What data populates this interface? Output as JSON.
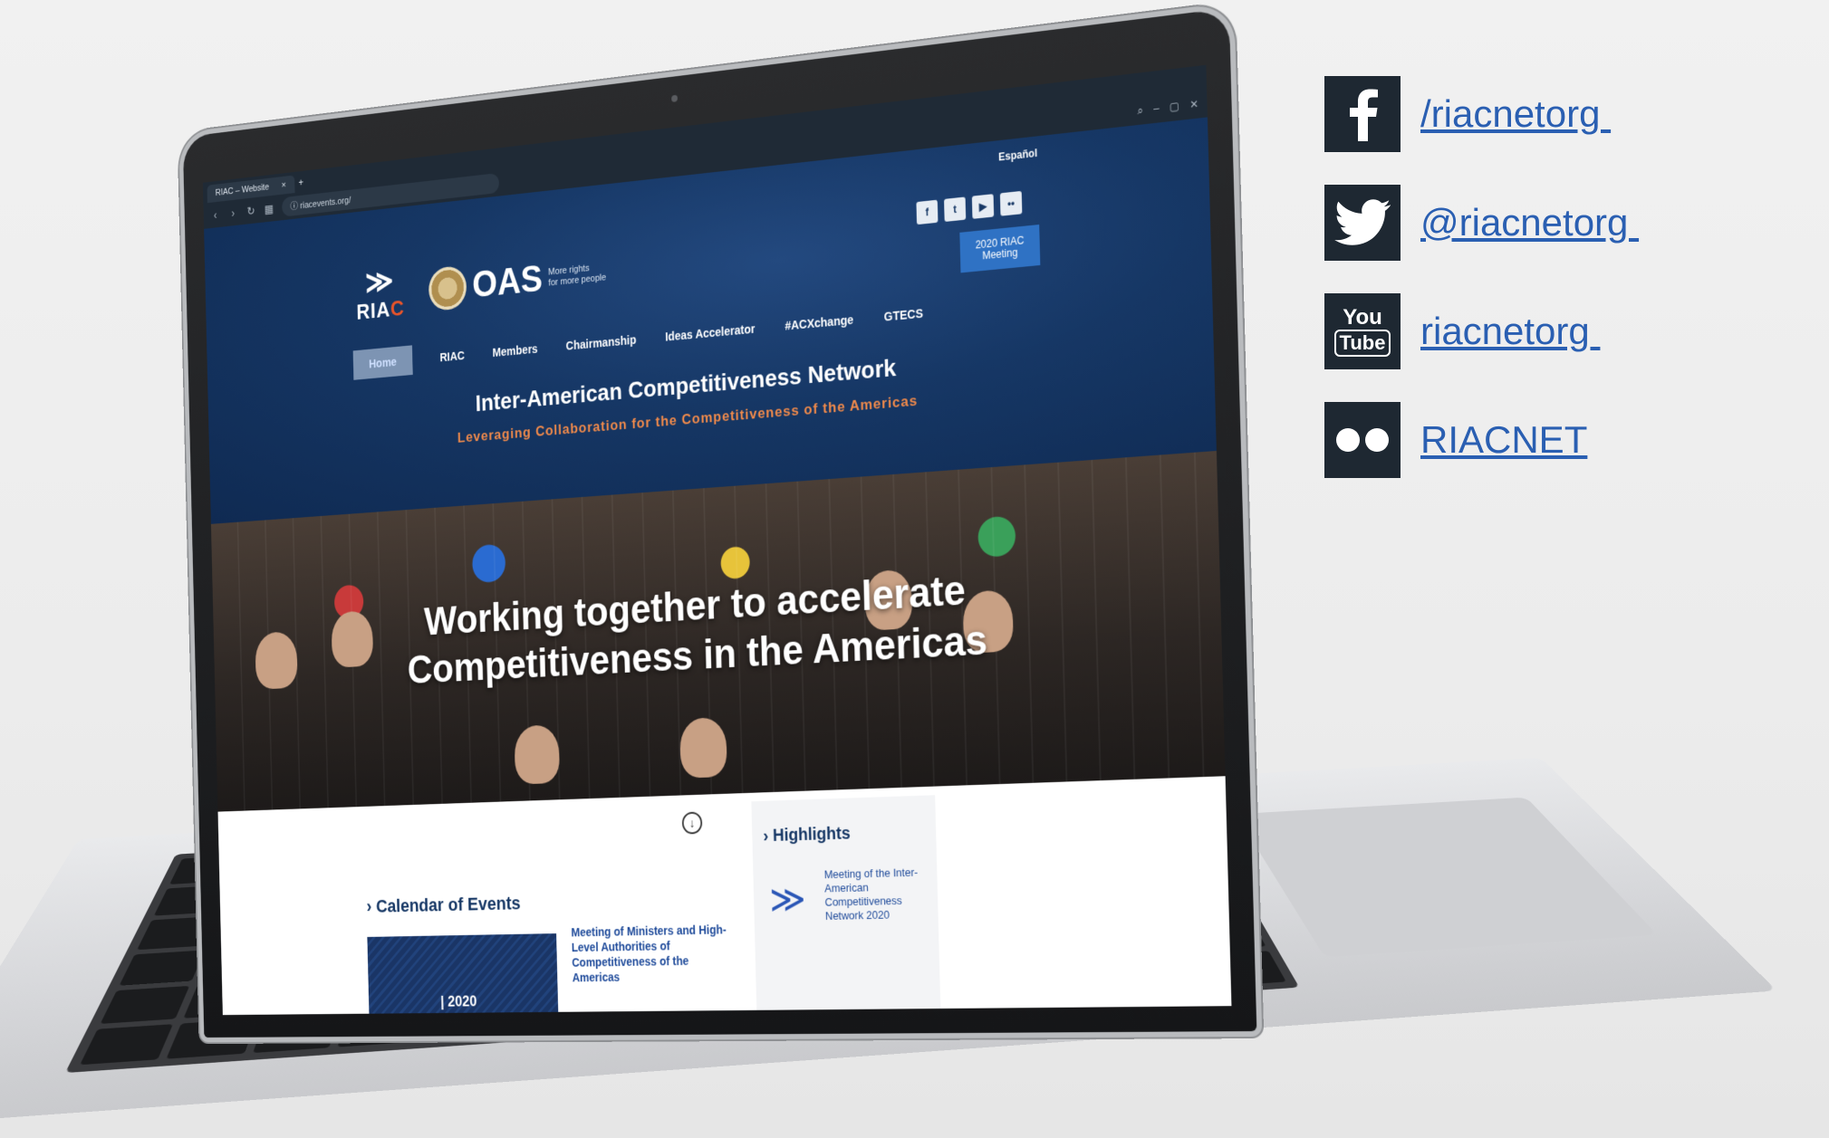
{
  "browser": {
    "tab_label": "RIAC – Website",
    "tab_close": "×",
    "new_tab": "+",
    "url": "riacevents.org/"
  },
  "site": {
    "language_link": "Español",
    "riac_logo_text": "RIA",
    "riac_logo_c": "C",
    "oas_text": "OAS",
    "oas_tagline_1": "More rights",
    "oas_tagline_2": "for more people",
    "meeting_button": "2020 RIAC Meeting",
    "nav": [
      "Home",
      "RIAC",
      "Members",
      "Chairmanship",
      "Ideas Accelerator",
      "#ACXchange",
      "GTECS"
    ],
    "title": "Inter-American Competitiveness Network",
    "tagline": "Leveraging Collaboration for the Competitiveness of the Americas",
    "hero_line_1": "Working together to accelerate",
    "hero_line_2": "Competitiveness in the Americas",
    "calendar_title": "Calendar of Events",
    "calendar_thumb_year": "| 2020",
    "calendar_event": "Meeting of Ministers and High-Level Authorities of Competitiveness of the Americas",
    "highlights_title": "Highlights",
    "highlights_text": "Meeting of the Inter-American Competitiveness Network 2020"
  },
  "social": [
    {
      "icon": "facebook-icon",
      "label": "/riacnetorg "
    },
    {
      "icon": "twitter-icon",
      "label": "@riacnetorg "
    },
    {
      "icon": "youtube-icon",
      "label": "riacnetorg "
    },
    {
      "icon": "flickr-icon",
      "label": "RIACNET"
    }
  ],
  "colors": {
    "header_blue": "#163765",
    "accent_orange": "#f08a4b",
    "link_blue": "#2a5fb2",
    "icon_bg": "#1e2832"
  }
}
